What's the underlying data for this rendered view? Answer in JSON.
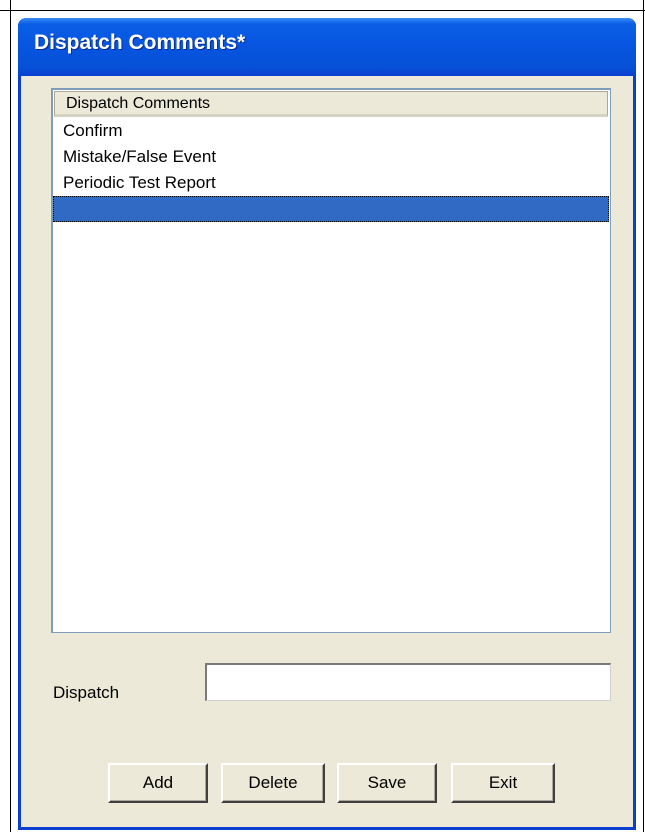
{
  "window": {
    "title": "Dispatch Comments*"
  },
  "list": {
    "column_header": "Dispatch Comments",
    "items": [
      {
        "label": "Confirm",
        "selected": false
      },
      {
        "label": "Mistake/False Event",
        "selected": false
      },
      {
        "label": "Periodic Test Report",
        "selected": false
      },
      {
        "label": "",
        "selected": true
      }
    ]
  },
  "form": {
    "dispatch_label": "Dispatch",
    "dispatch_value": "",
    "dispatch_placeholder": ""
  },
  "buttons": {
    "add": "Add",
    "delete": "Delete",
    "save": "Save",
    "exit": "Exit"
  },
  "colors": {
    "titlebar": "#0754e0",
    "window_bg": "#ece9d8",
    "selection": "#316ac5"
  }
}
